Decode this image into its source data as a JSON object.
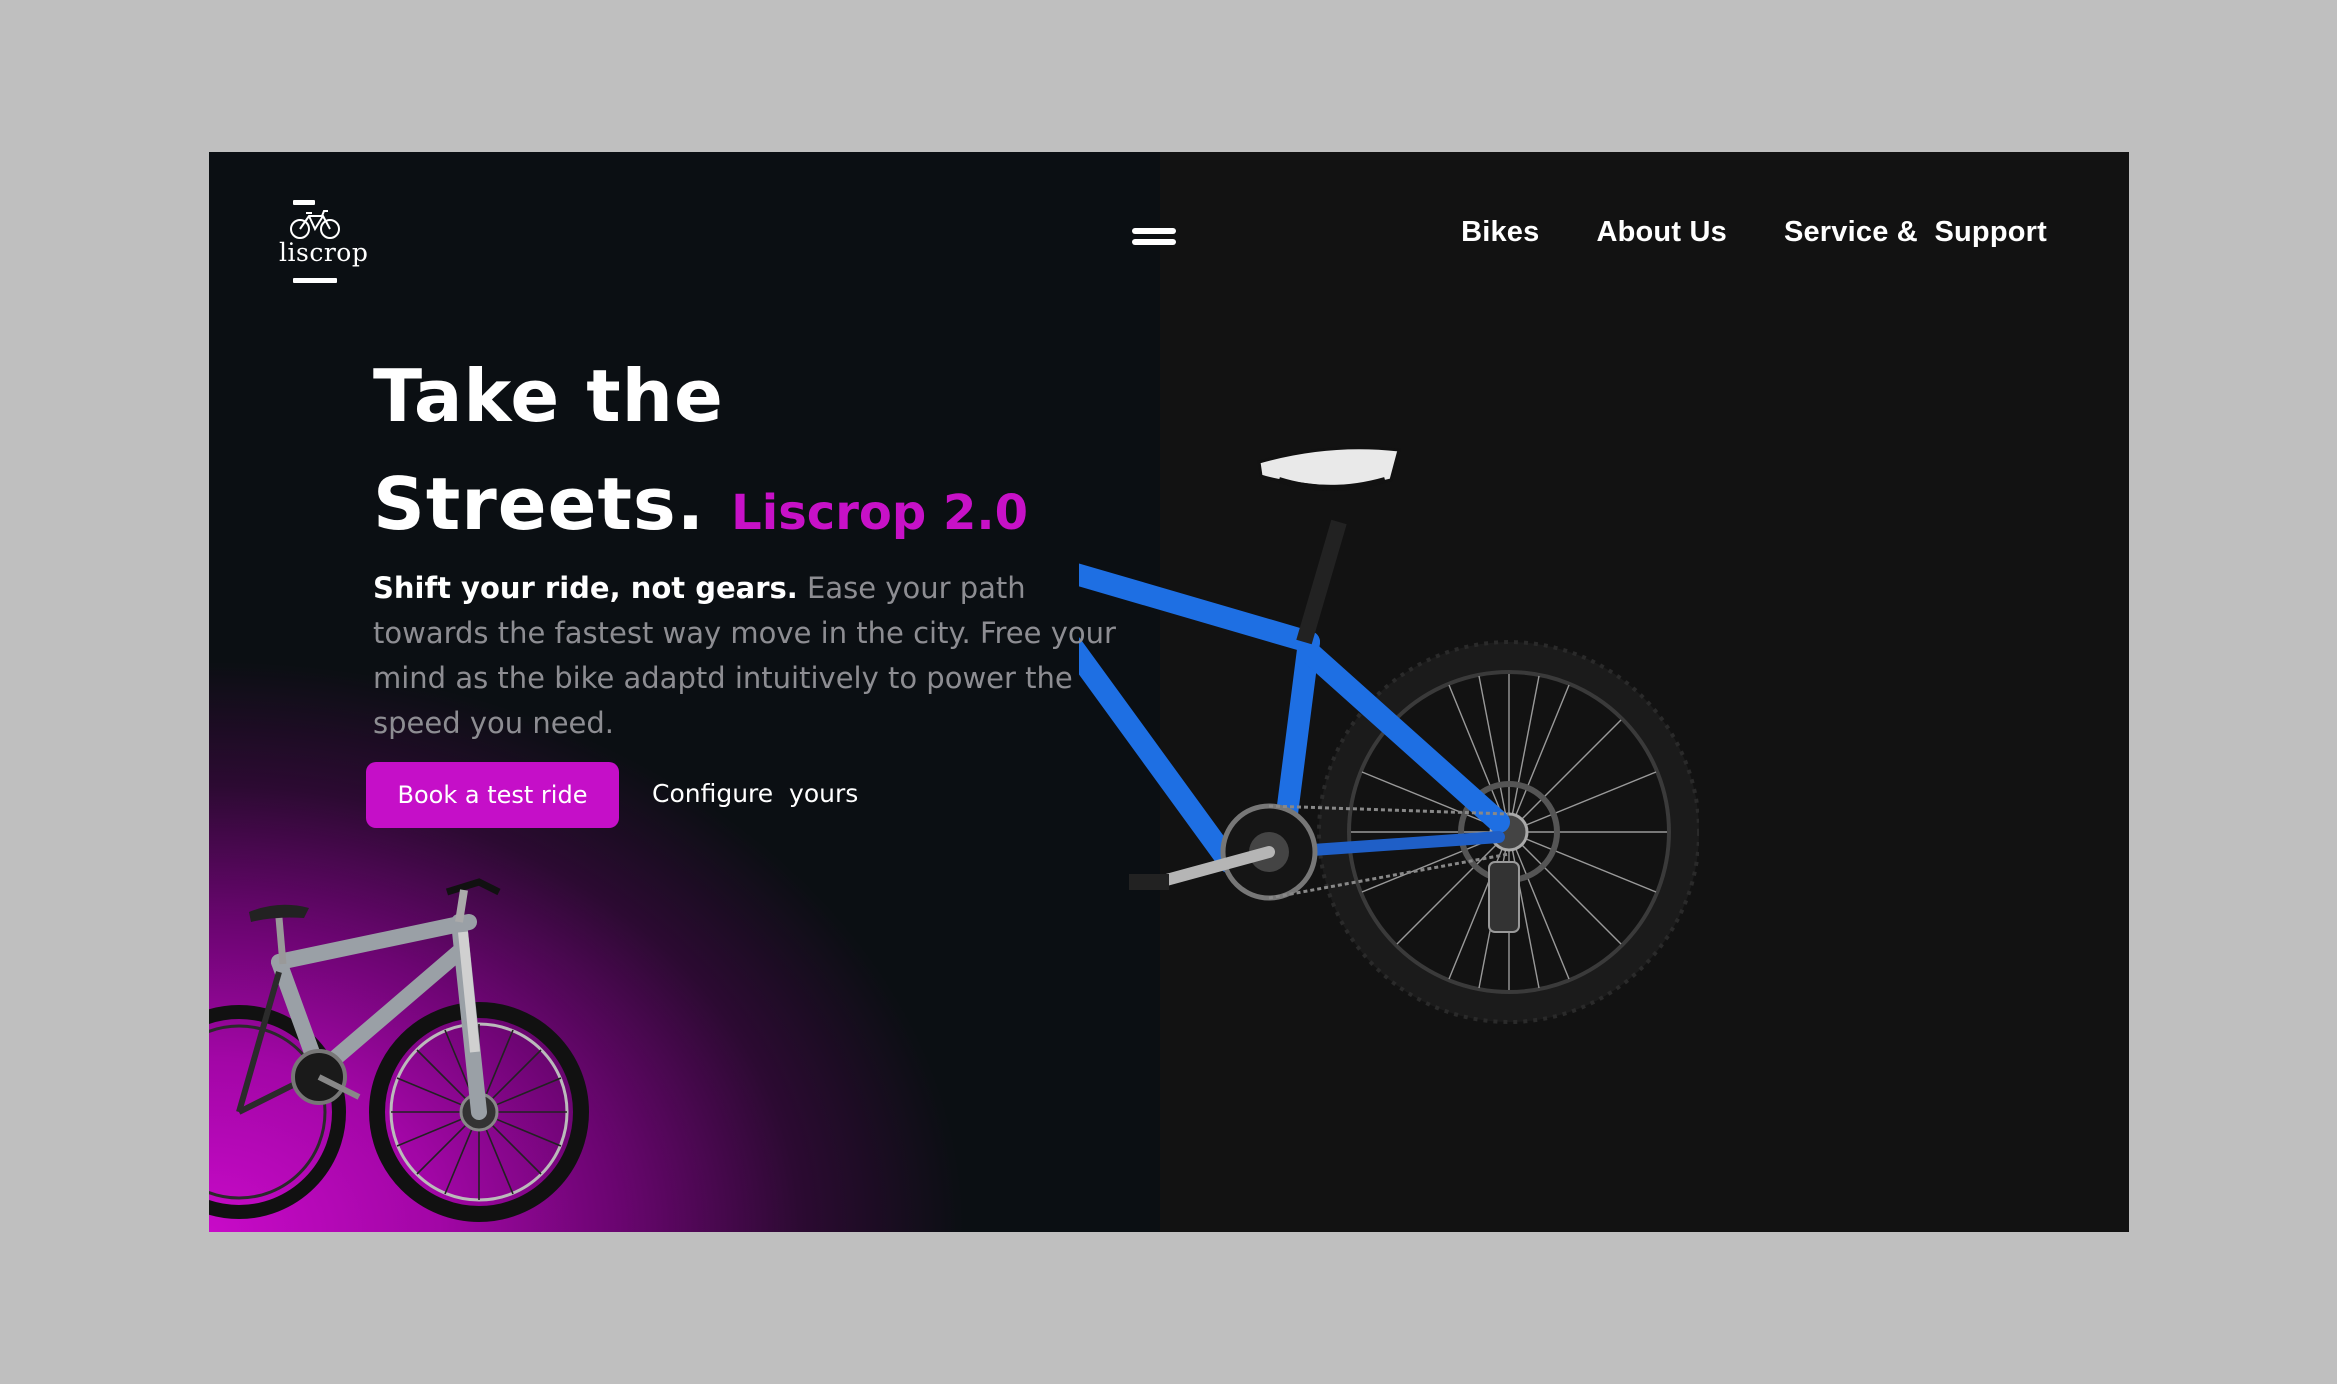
{
  "brand": {
    "name": "liscrop"
  },
  "nav": {
    "items": [
      {
        "label": "Bikes"
      },
      {
        "label": "About Us"
      },
      {
        "label": "Service &  Support"
      }
    ]
  },
  "hero": {
    "title_line1": "Take the",
    "title_line2": "Streets.",
    "model": "Liscrop 2.0",
    "tagline_bold": "Shift your ride, not gears.",
    "tagline_body": " Ease your path towards the fastest way move in the city. Free your mind as the bike adaptd intuitively to power the speed you need.",
    "primary_cta": "Book a test ride",
    "secondary_cta": "Configure  yours"
  },
  "colors": {
    "accent": "#c50fc8",
    "background_dark": "#0b0f13",
    "background_right": "#121212",
    "text_muted": "#8d8d92"
  }
}
